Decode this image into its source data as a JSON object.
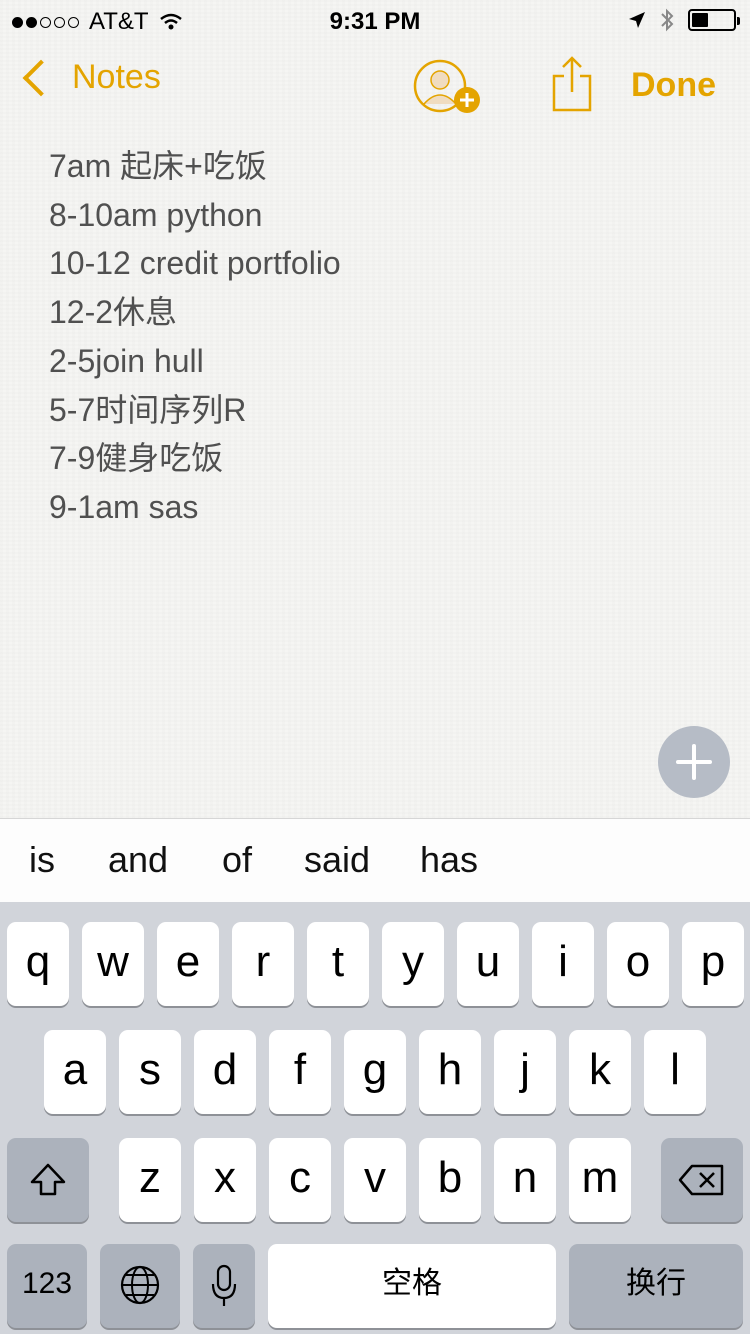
{
  "status_bar": {
    "carrier": "AT&T",
    "time": "9:31 PM",
    "signal_bars_filled": 2,
    "signal_bars_total": 5
  },
  "nav": {
    "back_label": "Notes",
    "done_label": "Done",
    "accent_color": "#e4a400"
  },
  "note": {
    "lines": [
      "7am 起床+吃饭",
      "8-10am python",
      "10-12 credit portfolio",
      "12-2休息",
      "2-5join hull",
      "5-7时间序列R",
      "7-9健身吃饭",
      "9-1am sas"
    ]
  },
  "suggestions": [
    "is",
    "and",
    "of",
    "said",
    "has"
  ],
  "keyboard": {
    "row1": [
      "q",
      "w",
      "e",
      "r",
      "t",
      "y",
      "u",
      "i",
      "o",
      "p"
    ],
    "row2": [
      "a",
      "s",
      "d",
      "f",
      "g",
      "h",
      "j",
      "k",
      "l"
    ],
    "row3": [
      "z",
      "x",
      "c",
      "v",
      "b",
      "n",
      "m"
    ],
    "numbers_label": "123",
    "space_label": "空格",
    "return_label": "换行"
  }
}
